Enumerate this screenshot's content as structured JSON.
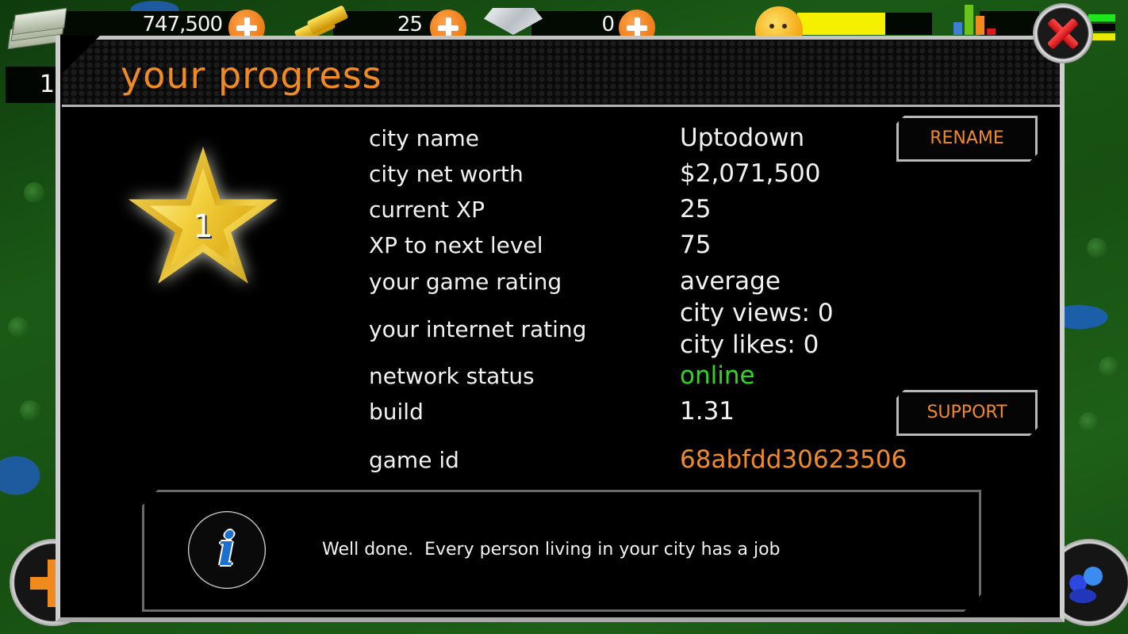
{
  "hud": {
    "money": "747,500",
    "gold": "25",
    "diamonds": "0",
    "happiness_level": 0.65,
    "player_level": "1"
  },
  "dialog": {
    "title": "your progress",
    "star_level": "1",
    "rows": [
      {
        "label": "city name",
        "value": "Uptodown"
      },
      {
        "label": "city net worth",
        "value": "$2,071,500"
      },
      {
        "label": "current XP",
        "value": "25"
      },
      {
        "label": "XP to next level",
        "value": "75"
      },
      {
        "label": "your game rating",
        "value": "average"
      },
      {
        "label": "your internet rating",
        "value_line1": "city views: 0",
        "value_line2": "city likes: 0"
      },
      {
        "label": "network status",
        "value": "online"
      },
      {
        "label": "build",
        "value": "1.31"
      },
      {
        "label": "game id",
        "value": "68abfdd30623506"
      }
    ],
    "buttons": {
      "rename": "RENAME",
      "support": "SUPPORT"
    },
    "message": "Well done.  Every person living in your city has a job"
  },
  "colors": {
    "accent_orange": "#f08a22",
    "status_online": "#2fd81e",
    "happiness_yellow": "#f5ef00",
    "close_red": "#d41a1f"
  },
  "icons": {
    "money": "money-stack-icon",
    "gold": "gold-bars-icon",
    "diamond": "diamond-icon",
    "happiness": "smiley-icon",
    "stats": "bar-chart-icon",
    "close": "close-x-icon",
    "info": "info-icon",
    "level": "star-icon",
    "build": "plus-icon",
    "social": "people-icon"
  }
}
